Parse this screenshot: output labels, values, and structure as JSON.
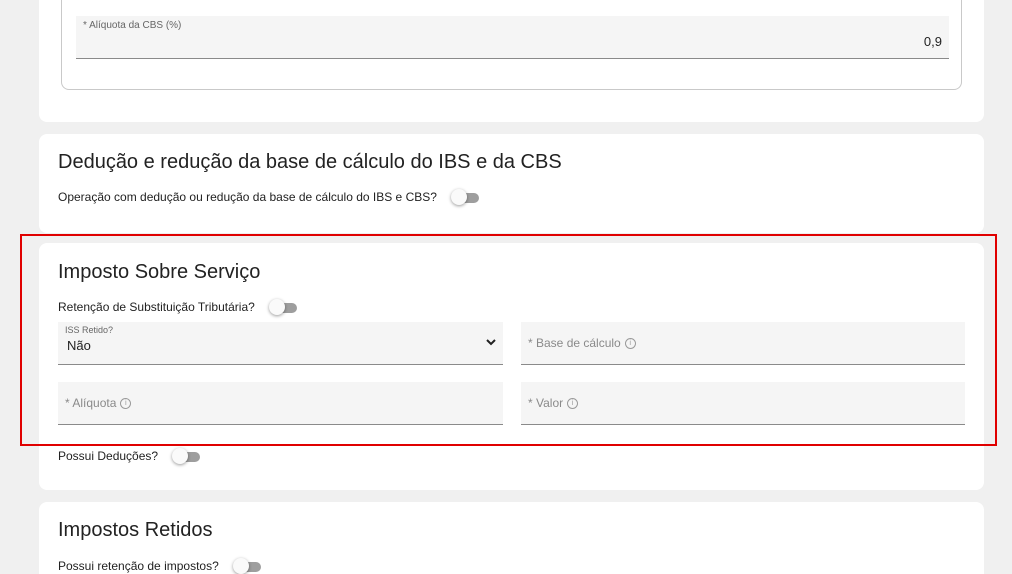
{
  "top_card": {
    "aliquota_cbs_label": "* Alíquota da CBS (%)",
    "aliquota_cbs_value": "0,9"
  },
  "deducao": {
    "title": "Dedução e redução da base de cálculo do IBS e da CBS",
    "toggle_label": "Operação com dedução ou redução da base de cálculo do IBS e CBS?"
  },
  "iss": {
    "title": "Imposto Sobre Serviço",
    "retencao_label": "Retenção de Substituição Tributária?",
    "iss_retido": {
      "label": "ISS Retido?",
      "value": "Não"
    },
    "base_calculo_placeholder": "* Base de cálculo",
    "aliquota_placeholder": "* Alíquota",
    "valor_placeholder": "* Valor",
    "deducoes_label": "Possui Deduções?"
  },
  "retidos": {
    "title": "Impostos Retidos",
    "toggle_label": "Possui retenção de impostos?"
  },
  "colors": {
    "highlight": "#e00000",
    "background": "#f0f0f0",
    "card": "#ffffff"
  },
  "icons": {
    "info": "info-icon",
    "chevron": "chevron-down-icon"
  }
}
